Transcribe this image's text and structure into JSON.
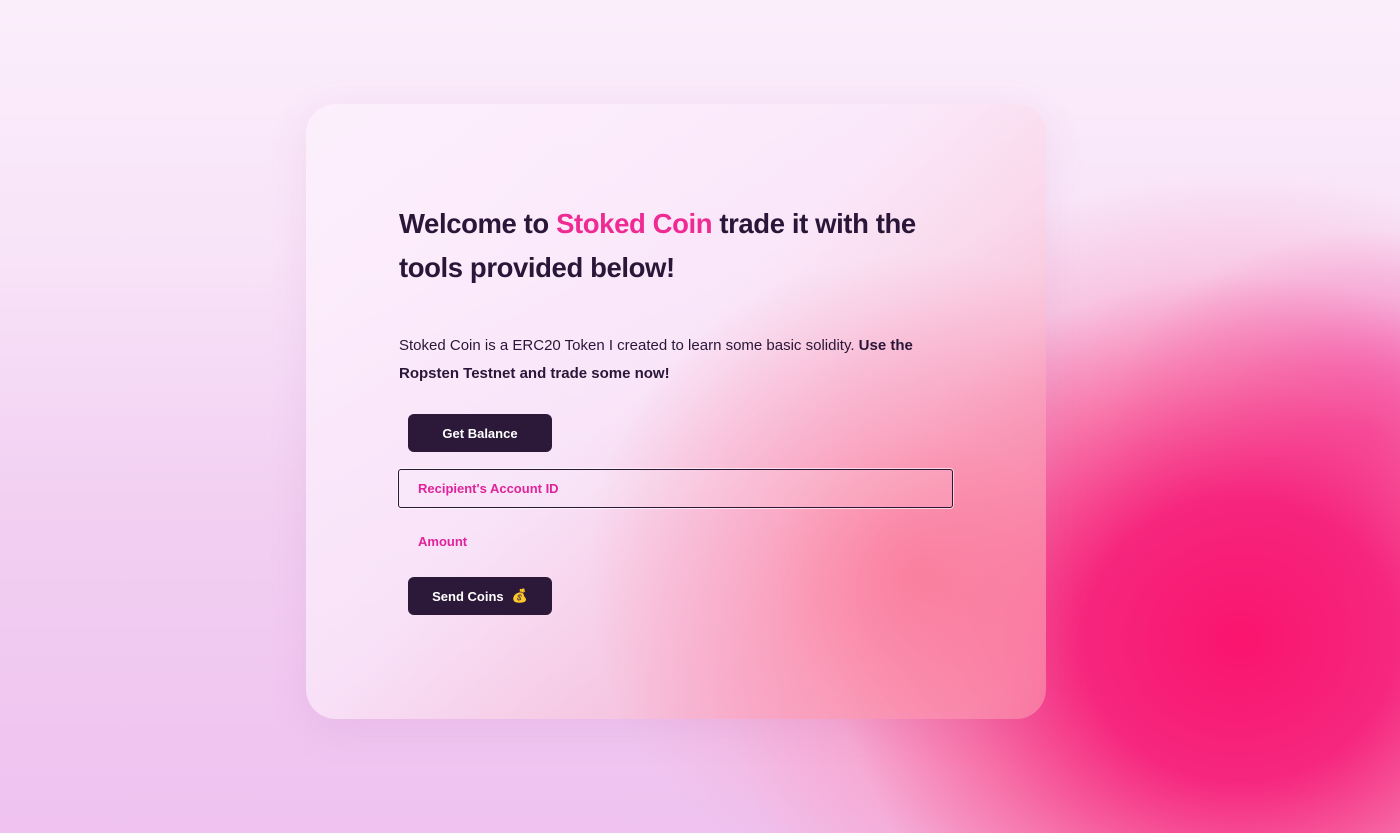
{
  "heading": {
    "prefix": "Welcome to ",
    "brand": "Stoked Coin",
    "suffix": " trade it with the tools provided below!"
  },
  "description": {
    "normal": "Stoked Coin is a ERC20 Token I created to learn some basic solidity.",
    "bold": " Use the Ropsten Testnet and trade some now!"
  },
  "actions": {
    "get_balance_label": "Get Balance",
    "send_coins_label": "Send Coins",
    "send_coins_emoji": "💰"
  },
  "form": {
    "recipient_placeholder": "Recipient's Account ID",
    "amount_placeholder": "Amount"
  },
  "colors": {
    "accent": "#ef2a93",
    "button_bg": "#2c1838",
    "text_dark": "#2a1638",
    "placeholder": "#e0239a"
  }
}
